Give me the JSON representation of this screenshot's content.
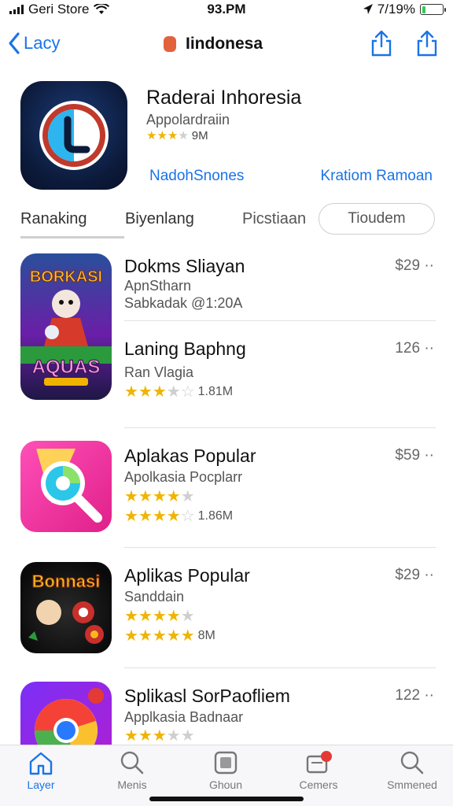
{
  "status_bar": {
    "carrier": "Geri Store",
    "time": "93.PM",
    "battery": "7/19%",
    "battery_level": 0.19
  },
  "nav": {
    "back_label": "Lacy",
    "title": "Iindonesa"
  },
  "header": {
    "title": "Raderai Inhoresia",
    "subtitle": "Appolardraiin",
    "rating_count": "9M",
    "rating": 3,
    "link_left": "NadohSnones",
    "link_right": "Kratiom Ramoan"
  },
  "tabs": {
    "t1": "Ranaking",
    "t2": "Biyenlang",
    "t3": "Picstiaan",
    "pill": "Tioudem"
  },
  "items": [
    {
      "title": "Dokms Sliayan",
      "line1": "ApnStharn",
      "line2": "Sabkadak @1:20A",
      "price": "$29 ··",
      "icon": "game-dokms-icon"
    },
    {
      "title": "Laning Baphng",
      "line1": "Ran Vlagia",
      "rating": 3,
      "count": "1.81M",
      "price": "126 ··"
    },
    {
      "title": "Aplakas Popular",
      "line1": "Apolkasia Pocplarr",
      "rating": 3.5,
      "count": "1.86M",
      "price": "$59 ··",
      "icon": "pink-search-icon"
    },
    {
      "title": "Aplikas Popular",
      "line1": "Sanddain",
      "rating": 3.5,
      "count": "8M",
      "price": "$29 ··",
      "icon": "game-bonnasi-icon"
    },
    {
      "title": "Splikasl SorPaofliem",
      "line1": "Applkasia Badnaar",
      "rating": 3,
      "price": "122 ··",
      "icon": "chrome-like-icon"
    }
  ],
  "icon_text": {
    "game1_top": "BORKASI",
    "game1_bottom": "AQUAS",
    "game2_top": "Bonnasi"
  },
  "tab_bar": {
    "t1": "Layer",
    "t2": "Menis",
    "t3": "Ghoun",
    "t4": "Cemers",
    "t5": "Smmened"
  },
  "colors": {
    "accent": "#1a73e8",
    "star": "#f0b400",
    "badge": "#e53935"
  }
}
